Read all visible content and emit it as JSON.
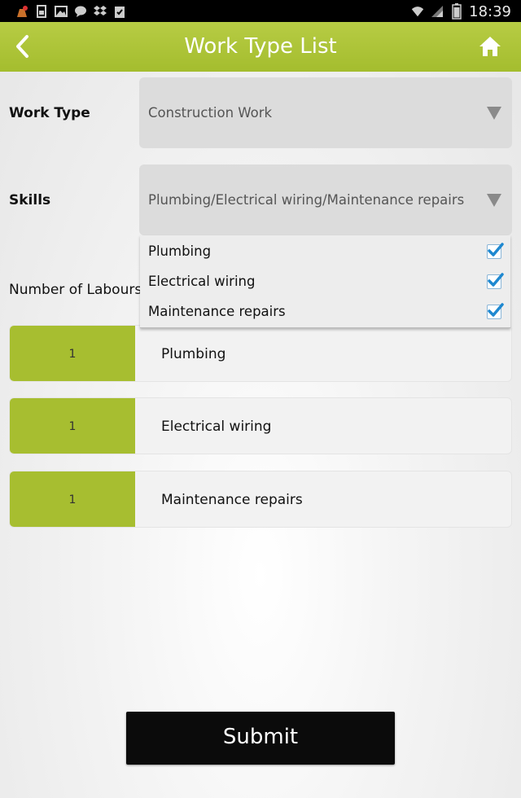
{
  "status_bar": {
    "time": "18:39",
    "left_icons": [
      "app-notification-icon",
      "sim-icon",
      "image-icon",
      "chat-icon",
      "dropbox-icon",
      "clipboard-icon"
    ],
    "right_icons": [
      "wifi-icon",
      "signal-icon",
      "battery-icon"
    ]
  },
  "header": {
    "title": "Work Type List",
    "back_icon": "chevron-left-icon",
    "home_icon": "home-icon",
    "background": "#a8c034"
  },
  "form": {
    "work_type": {
      "label": "Work Type",
      "value": "Construction Work"
    },
    "skills": {
      "label": "Skills",
      "value": "Plumbing/Electrical wiring/Maintenance repairs",
      "options": [
        {
          "label": "Plumbing",
          "checked": true
        },
        {
          "label": "Electrical wiring",
          "checked": true
        },
        {
          "label": "Maintenance repairs",
          "checked": true
        }
      ]
    },
    "labours_label": "Number of Labours",
    "labours": [
      {
        "count": "1",
        "skill": "Plumbing"
      },
      {
        "count": "1",
        "skill": "Electrical wiring"
      },
      {
        "count": "1",
        "skill": "Maintenance repairs"
      }
    ]
  },
  "submit_label": "Submit",
  "colors": {
    "accent": "#a7be30",
    "header_text": "#ffffff",
    "submit_bg": "#0b0b0b",
    "checkbox": "#1e88d0"
  }
}
